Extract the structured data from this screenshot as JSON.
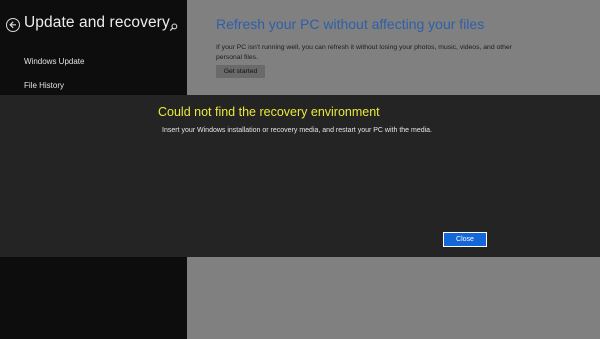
{
  "settings": {
    "title": "Update and recovery",
    "nav": [
      {
        "label": "Windows Update"
      },
      {
        "label": "File History"
      }
    ]
  },
  "content": {
    "title": "Refresh your PC without affecting your files",
    "description": "If your PC isn't running well, you can refresh it without losing your photos, music, videos, and other personal files.",
    "button_label": "Get started"
  },
  "dialog": {
    "title": "Could not find the recovery environment",
    "message": "Insert your Windows installation or recovery media, and restart your PC with the media.",
    "close_label": "Close"
  },
  "icons": {
    "back": "back-arrow-icon",
    "search": "search-icon"
  },
  "colors": {
    "accent_blue": "#1467d8",
    "dialog_title_yellow": "#e9e93a",
    "content_title_blue": "#2e5fa8"
  }
}
